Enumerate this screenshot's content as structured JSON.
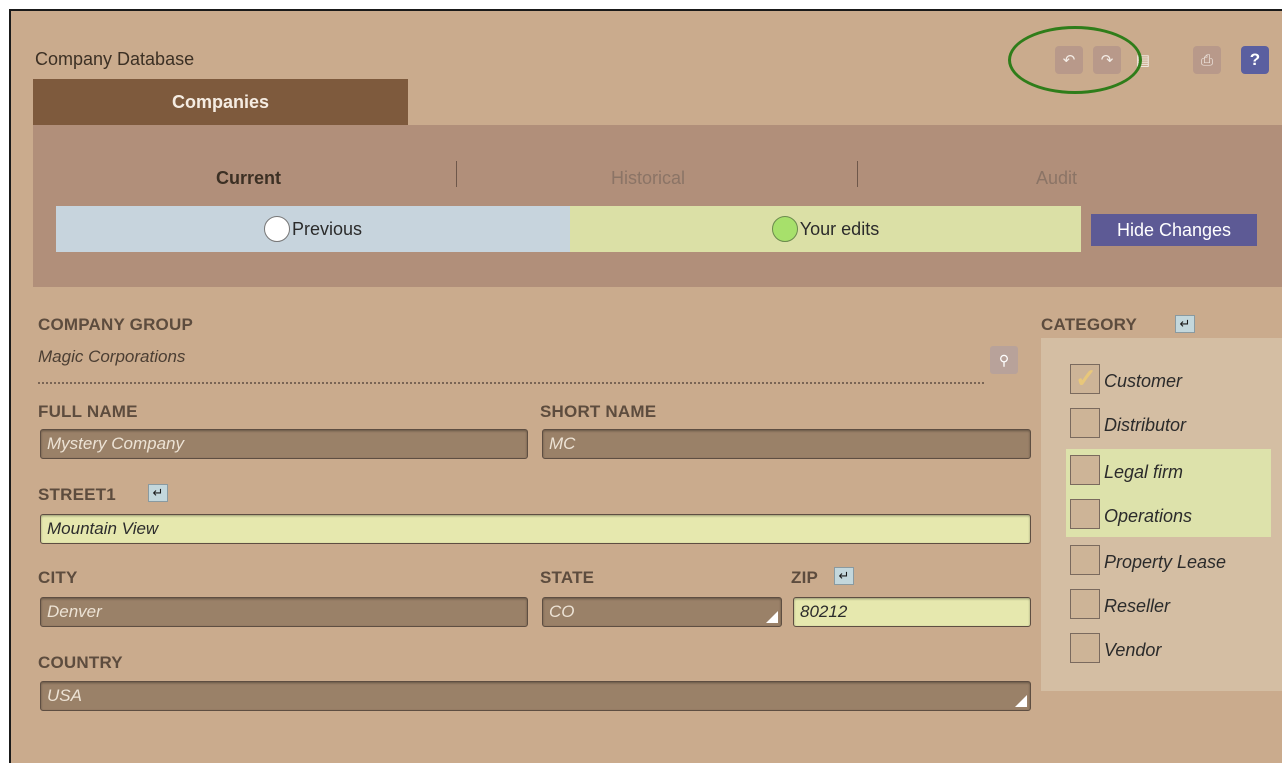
{
  "app": {
    "title": "Company Database"
  },
  "toolbar": {
    "undo_icon": "undo-icon",
    "redo_icon": "redo-icon",
    "columns_icon": "columns-icon",
    "print_icon": "print-icon",
    "help_label": "?"
  },
  "tabs": {
    "active": "Companies"
  },
  "subtabs": {
    "current": "Current",
    "historical": "Historical",
    "audit": "Audit"
  },
  "compare": {
    "previous": "Previous",
    "your_edits": "Your edits",
    "hide_button": "Hide Changes"
  },
  "form": {
    "company_group": {
      "label": "COMPANY GROUP",
      "value": "Magic Corporations"
    },
    "full_name": {
      "label": "FULL NAME",
      "value": "Mystery Company"
    },
    "short_name": {
      "label": "SHORT NAME",
      "value": "MC"
    },
    "street1": {
      "label": "STREET1",
      "value": "Mountain View"
    },
    "city": {
      "label": "CITY",
      "value": "Denver"
    },
    "state": {
      "label": "STATE",
      "value": "CO"
    },
    "zip": {
      "label": "ZIP",
      "value": "80212"
    },
    "country": {
      "label": "COUNTRY",
      "value": "USA"
    }
  },
  "category": {
    "label": "CATEGORY",
    "items": [
      {
        "label": "Customer",
        "checked": true
      },
      {
        "label": "Distributor",
        "checked": false
      },
      {
        "label": "Legal firm",
        "checked": false
      },
      {
        "label": "Operations",
        "checked": false
      },
      {
        "label": "Property Lease",
        "checked": false
      },
      {
        "label": "Reseller",
        "checked": false
      },
      {
        "label": "Vendor",
        "checked": false
      }
    ]
  },
  "colors": {
    "background": "#caab8d",
    "active_tab": "#7e5a3d",
    "edited_field": "#e6e8ae",
    "previous_band": "#c7d4dd",
    "hide_button": "#5d5a95",
    "highlight_ring": "#2f7d1a"
  }
}
